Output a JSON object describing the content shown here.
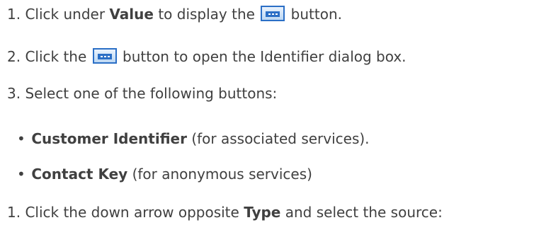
{
  "steps_a": [
    {
      "number": "1.",
      "pre": "Click under",
      "bold": "Value",
      "mid": "to display the",
      "post": "button."
    },
    {
      "number": "2.",
      "pre": "Click the",
      "post": "button to open the Identifier dialog box."
    },
    {
      "number": "3.",
      "text": "Select one of the following buttons:"
    }
  ],
  "bullets": [
    {
      "bold": "Customer Identifier",
      "rest": "(for associated services)."
    },
    {
      "bold": "Contact Key",
      "rest": "(for anonymous services)"
    }
  ],
  "steps_b": [
    {
      "number": "1.",
      "pre": "Click the down arrow opposite",
      "bold": "Type",
      "post": "and select the source:"
    }
  ],
  "icons": {
    "value_button": "ellipsis-button-icon"
  },
  "colors": {
    "text": "#404040",
    "icon_accent": "#2b6fc6"
  }
}
